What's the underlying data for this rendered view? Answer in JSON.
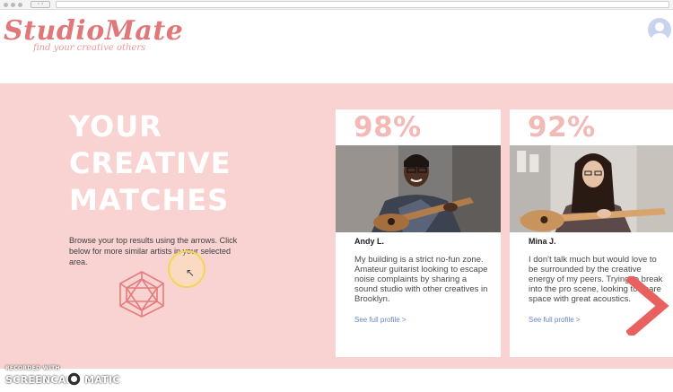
{
  "browser": {
    "nav_arrows": "‹ ›"
  },
  "header": {
    "logo": "StudioMate",
    "tagline": "find your creative others",
    "avatar_icon": "user-avatar-icon"
  },
  "hero": {
    "title_line1": "YOUR",
    "title_line2": "CREATIVE",
    "title_line3": "MATCHES",
    "description": "Browse your top results using the arrows. Click below for more similar artists in your selected area.",
    "hex_icon": "geodesic-hexagon-icon"
  },
  "matches": [
    {
      "percent": "98%",
      "name": "Andy L.",
      "bio": "My building is a strict no-fun zone. Amateur guitarist looking to escape noise complaints by sharing a sound studio with other creatives in Brooklyn.",
      "link": "See full profile >"
    },
    {
      "percent": "92%",
      "name": "Mina J.",
      "bio": "I don't talk much but would love to be surrounded by the creative energy of my peers. Trying to break into the pro scene, looking to share space with great acoustics.",
      "link": "See full profile >"
    }
  ],
  "next_arrow_icon": "chevron-right-icon",
  "watermark": {
    "recorded_with": "RECORDED WITH",
    "brand_left": "SCREENCAST",
    "brand_right": "MATIC"
  },
  "colors": {
    "brand": "#e0787a",
    "hero_bg": "#f9d3d2",
    "percent": "#f2b9b7",
    "link": "#6a86c9",
    "arrow": "#e8615f"
  }
}
